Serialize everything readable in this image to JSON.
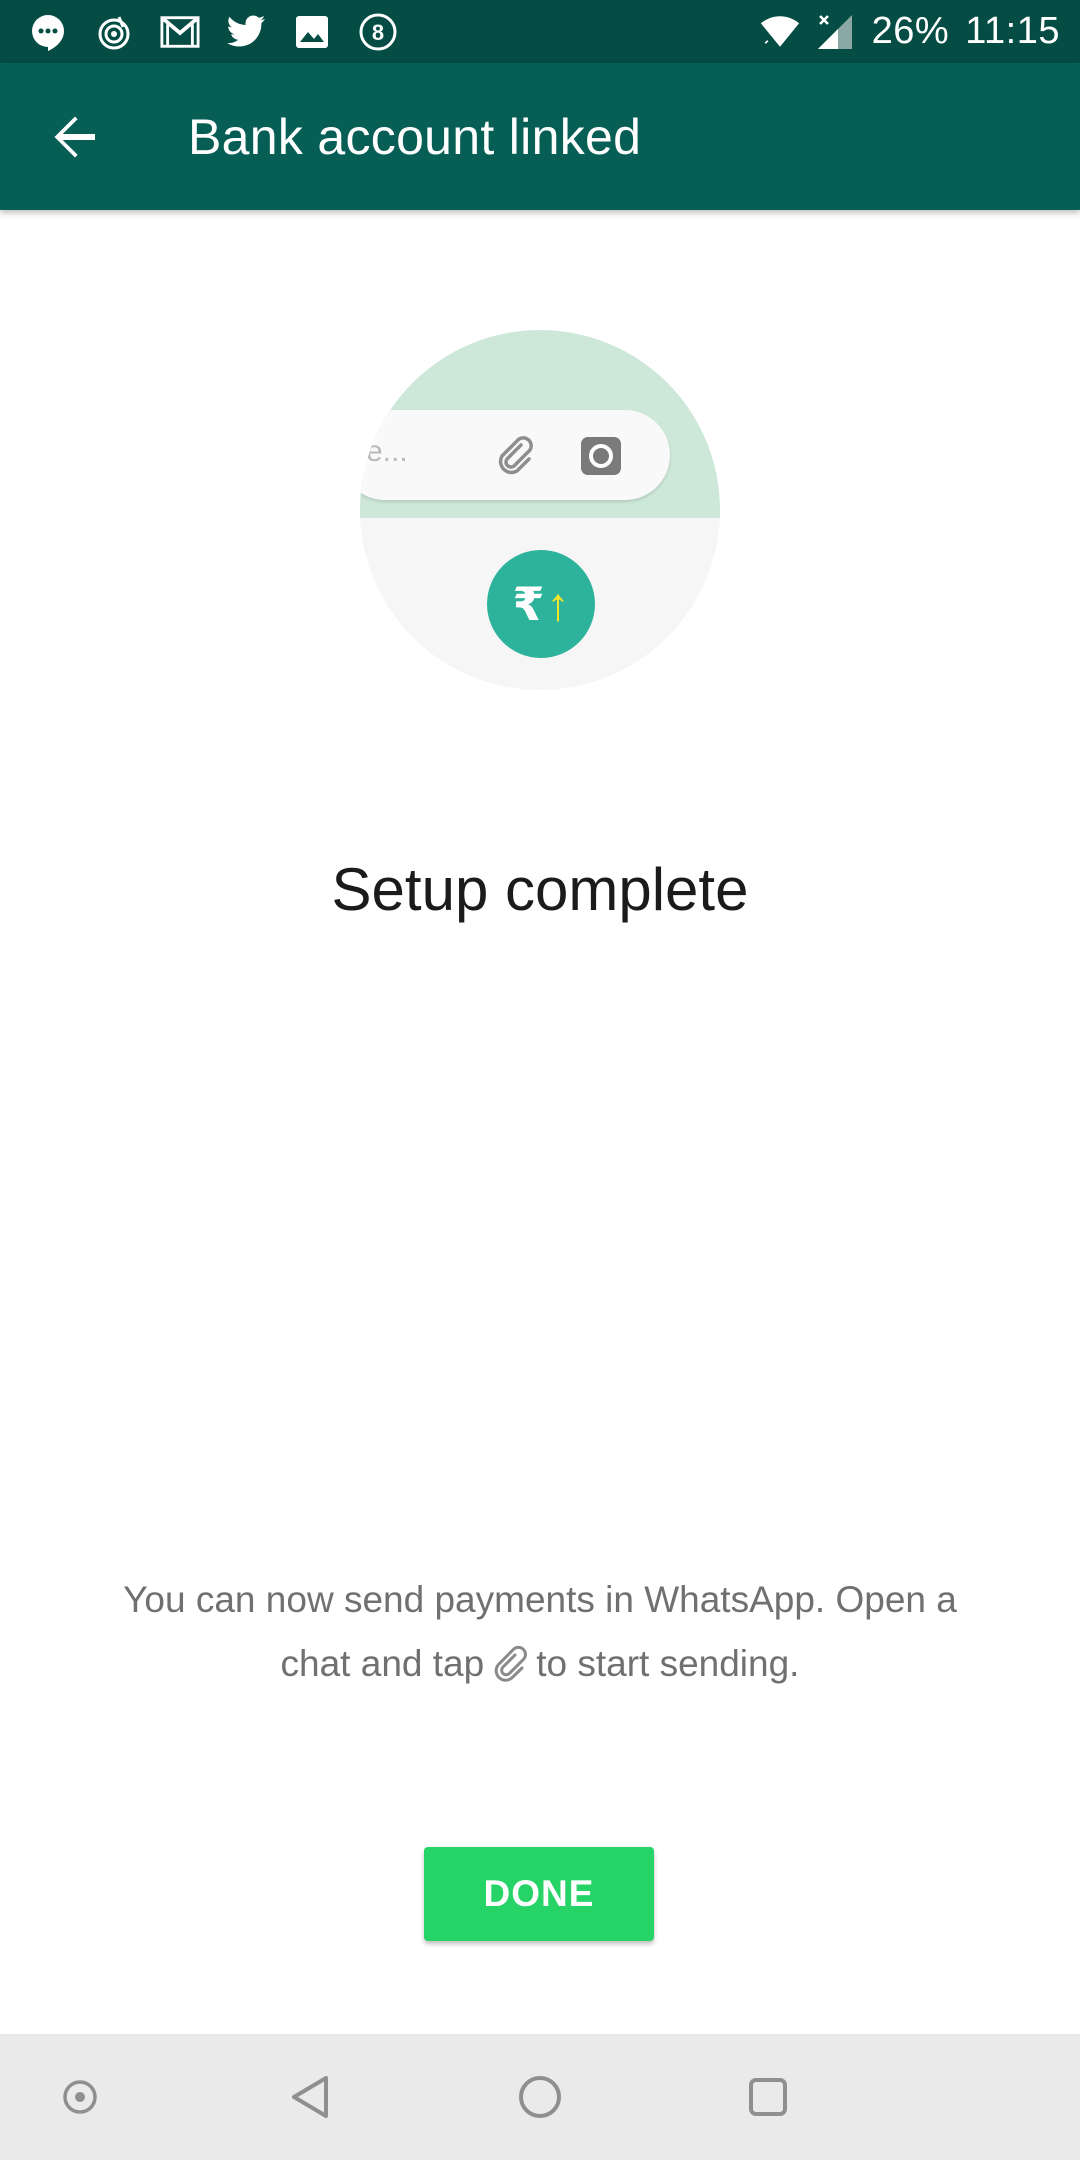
{
  "status_bar": {
    "notification_icons": [
      "hangouts-icon",
      "beatport-icon",
      "gmail-icon",
      "twitter-icon",
      "gallery-icon",
      "eight-app-icon"
    ],
    "battery": "26%",
    "time": "11:15"
  },
  "app_bar": {
    "title": "Bank account linked",
    "back_icon": "arrow-back-icon",
    "color": "#075e54"
  },
  "illustration": {
    "input_hint": "e...",
    "currency_symbol": "₹",
    "arrow": "↑",
    "accent": "#2db39b"
  },
  "main": {
    "headline": "Setup complete",
    "description_before": "You can now send payments in WhatsApp. Open a chat and tap",
    "description_after": "to start sending."
  },
  "actions": {
    "done_label": "DONE",
    "done_color": "#25d366"
  },
  "nav_bar": {
    "icons": [
      "pin-dot-icon",
      "back-triangle-icon",
      "home-circle-icon",
      "recents-square-icon"
    ]
  }
}
